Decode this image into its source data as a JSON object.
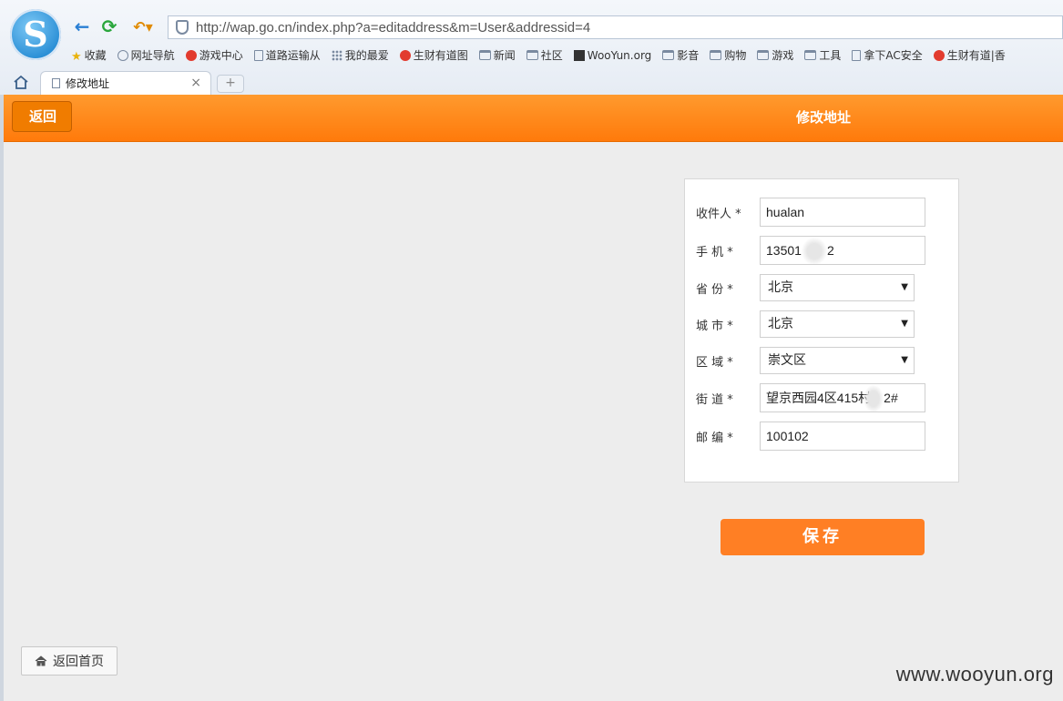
{
  "browser": {
    "url": "http://wap.go.cn/index.php?a=editaddress&m=User&addressid=4",
    "bookmarks": [
      {
        "label": "收藏",
        "icon": "star-icon"
      },
      {
        "label": "网址导航",
        "icon": "globe-icon"
      },
      {
        "label": "游戏中心",
        "icon": "game-icon"
      },
      {
        "label": "道路运输从",
        "icon": "page-icon"
      },
      {
        "label": "我的最爱",
        "icon": "grid-icon"
      },
      {
        "label": "生财有道图",
        "icon": "red-badge-icon"
      },
      {
        "label": "新闻",
        "icon": "folder-icon"
      },
      {
        "label": "社区",
        "icon": "folder-icon"
      },
      {
        "label": "WooYun.org",
        "icon": "wooyun-icon"
      },
      {
        "label": "影音",
        "icon": "folder-icon"
      },
      {
        "label": "购物",
        "icon": "folder-icon"
      },
      {
        "label": "游戏",
        "icon": "folder-icon"
      },
      {
        "label": "工具",
        "icon": "folder-icon"
      },
      {
        "label": "拿下AC安全",
        "icon": "page-icon"
      },
      {
        "label": "生财有道|香",
        "icon": "red-badge-icon"
      }
    ],
    "tab": {
      "label": "修改地址",
      "close": "×"
    },
    "newtab": "+"
  },
  "header": {
    "back_label": "返回",
    "title": "修改地址"
  },
  "form": {
    "recipient": {
      "label": "收件人 *",
      "value": "hualan"
    },
    "phone": {
      "label": "手  机 *",
      "value_start": "13501",
      "value_end": "2"
    },
    "province": {
      "label": "省  份 *",
      "value": "北京"
    },
    "city": {
      "label": "城  市 *",
      "value": "北京"
    },
    "district": {
      "label": "区  域 *",
      "value": "崇文区"
    },
    "street": {
      "label": "街  道 *",
      "value_start": "望京西园4区415村",
      "value_end": "2#"
    },
    "zipcode": {
      "label": "邮  编 *",
      "value": "100102"
    }
  },
  "save_label": "保存",
  "home_label": "返回首页",
  "watermark": "www.wooyun.org",
  "colors": {
    "accent": "#ff7f24",
    "header": "#ff8a1a"
  }
}
